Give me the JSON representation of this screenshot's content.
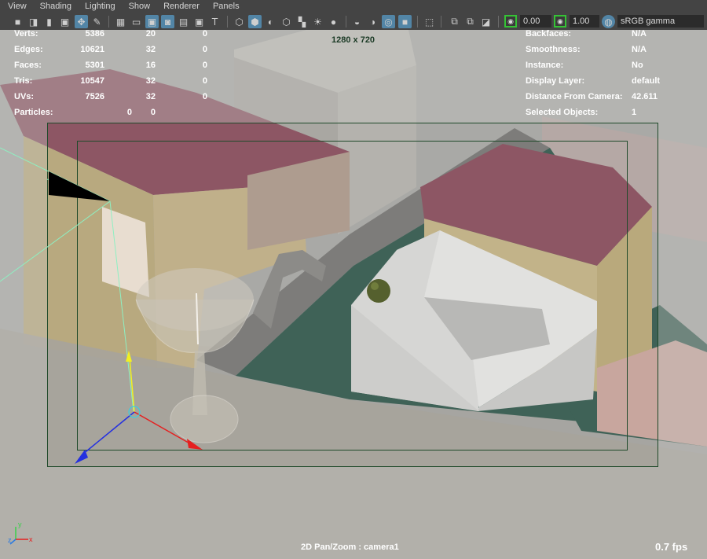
{
  "menus": [
    "View",
    "Shading",
    "Lighting",
    "Show",
    "Renderer",
    "Panels"
  ],
  "toolbar": {
    "field1": "0.00",
    "field2": "1.00",
    "colorspace": "sRGB gamma"
  },
  "hud_left": {
    "rows": [
      {
        "label": "Verts:",
        "v1": "5386",
        "v2": "20",
        "v3": "0"
      },
      {
        "label": "Edges:",
        "v1": "10621",
        "v2": "32",
        "v3": "0"
      },
      {
        "label": "Faces:",
        "v1": "5301",
        "v2": "16",
        "v3": "0"
      },
      {
        "label": "Tris:",
        "v1": "10547",
        "v2": "32",
        "v3": "0"
      },
      {
        "label": "UVs:",
        "v1": "7526",
        "v2": "32",
        "v3": "0"
      }
    ],
    "particles": {
      "label": "Particles:",
      "v2": "0",
      "v3": "0"
    }
  },
  "hud_right": [
    {
      "label": "Backfaces:",
      "value": "N/A"
    },
    {
      "label": "Smoothness:",
      "value": "N/A"
    },
    {
      "label": "Instance:",
      "value": "No"
    },
    {
      "label": "Display Layer:",
      "value": "default"
    },
    {
      "label": "Distance From Camera:",
      "value": "42.611"
    },
    {
      "label": "Selected Objects:",
      "value": "1"
    }
  ],
  "resolution": "1280 x 720",
  "status": "2D Pan/Zoom : camera1",
  "fps": "0.7 fps",
  "axis": {
    "y": "y",
    "z": "z",
    "x": "x"
  },
  "colors": {
    "menubar_bg": "#444444",
    "active_icon": "#5285a6",
    "gate_border": "#1f4a2a",
    "roof": "#8a5060",
    "wall": "#b9a982",
    "water": "#40625a"
  }
}
